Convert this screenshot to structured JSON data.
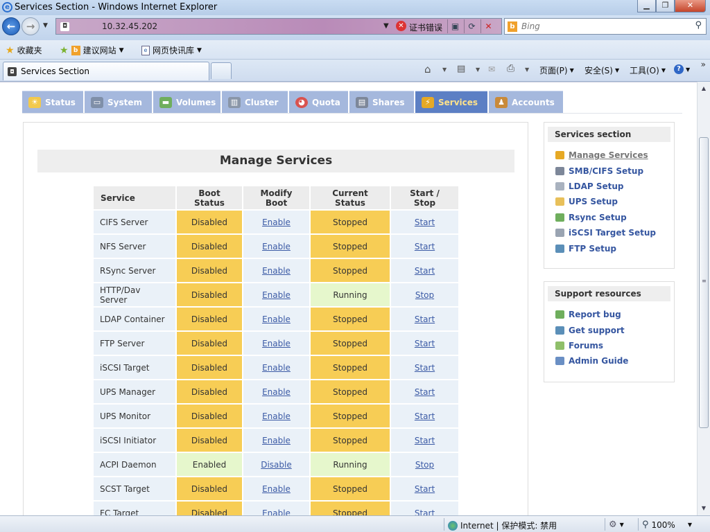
{
  "window": {
    "title": "Services Section - Windows Internet Explorer"
  },
  "address": {
    "host": "10.32.45.202",
    "cert_error": "证书错误"
  },
  "search": {
    "placeholder": "Bing"
  },
  "favbar": {
    "favorites": "收藏夹",
    "suggested": "建议网站",
    "webslice": "网页快讯库"
  },
  "browser_tab": {
    "title": "Services Section"
  },
  "commandbar": {
    "page": "页面(P)",
    "safety": "安全(S)",
    "tools": "工具(O)"
  },
  "statusbar": {
    "zone": "Internet | 保护模式: 禁用",
    "zoom": "100%"
  },
  "nav": [
    {
      "label": "Status"
    },
    {
      "label": "System"
    },
    {
      "label": "Volumes"
    },
    {
      "label": "Cluster"
    },
    {
      "label": "Quota"
    },
    {
      "label": "Shares"
    },
    {
      "label": "Services"
    },
    {
      "label": "Accounts"
    }
  ],
  "main": {
    "heading": "Manage Services",
    "columns": {
      "service": "Service",
      "boot": "Boot Status",
      "modify": "Modify Boot",
      "current": "Current Status",
      "action": "Start / Stop"
    },
    "rows": [
      {
        "service": "CIFS Server",
        "boot": "Disabled",
        "modify": "Enable",
        "current": "Stopped",
        "action": "Start"
      },
      {
        "service": "NFS Server",
        "boot": "Disabled",
        "modify": "Enable",
        "current": "Stopped",
        "action": "Start"
      },
      {
        "service": "RSync Server",
        "boot": "Disabled",
        "modify": "Enable",
        "current": "Stopped",
        "action": "Start"
      },
      {
        "service": "HTTP/Dav Server",
        "boot": "Disabled",
        "modify": "Enable",
        "current": "Running",
        "action": "Stop"
      },
      {
        "service": "LDAP Container",
        "boot": "Disabled",
        "modify": "Enable",
        "current": "Stopped",
        "action": "Start"
      },
      {
        "service": "FTP Server",
        "boot": "Disabled",
        "modify": "Enable",
        "current": "Stopped",
        "action": "Start"
      },
      {
        "service": "iSCSI Target",
        "boot": "Disabled",
        "modify": "Enable",
        "current": "Stopped",
        "action": "Start"
      },
      {
        "service": "UPS Manager",
        "boot": "Disabled",
        "modify": "Enable",
        "current": "Stopped",
        "action": "Start"
      },
      {
        "service": "UPS Monitor",
        "boot": "Disabled",
        "modify": "Enable",
        "current": "Stopped",
        "action": "Start"
      },
      {
        "service": "iSCSI Initiator",
        "boot": "Disabled",
        "modify": "Enable",
        "current": "Stopped",
        "action": "Start"
      },
      {
        "service": "ACPI Daemon",
        "boot": "Enabled",
        "modify": "Disable",
        "current": "Running",
        "action": "Stop"
      },
      {
        "service": "SCST Target",
        "boot": "Disabled",
        "modify": "Enable",
        "current": "Stopped",
        "action": "Start"
      },
      {
        "service": "FC Target",
        "boot": "Disabled",
        "modify": "Enable",
        "current": "Stopped",
        "action": "Start"
      }
    ]
  },
  "sidebar": {
    "services": {
      "title": "Services section",
      "items": [
        {
          "label": "Manage Services"
        },
        {
          "label": "SMB/CIFS Setup"
        },
        {
          "label": "LDAP Setup"
        },
        {
          "label": "UPS Setup"
        },
        {
          "label": "Rsync Setup"
        },
        {
          "label": "iSCSI Target Setup"
        },
        {
          "label": "FTP Setup"
        }
      ]
    },
    "support": {
      "title": "Support resources",
      "items": [
        {
          "label": "Report bug"
        },
        {
          "label": "Get support"
        },
        {
          "label": "Forums"
        },
        {
          "label": "Admin Guide"
        }
      ]
    }
  },
  "colors": {
    "boot_disabled": "#f7cd55",
    "enabled_or_running": "#e6f7cc",
    "nav_active": "#5c7fc4",
    "nav_inactive": "#a5b8dd"
  }
}
